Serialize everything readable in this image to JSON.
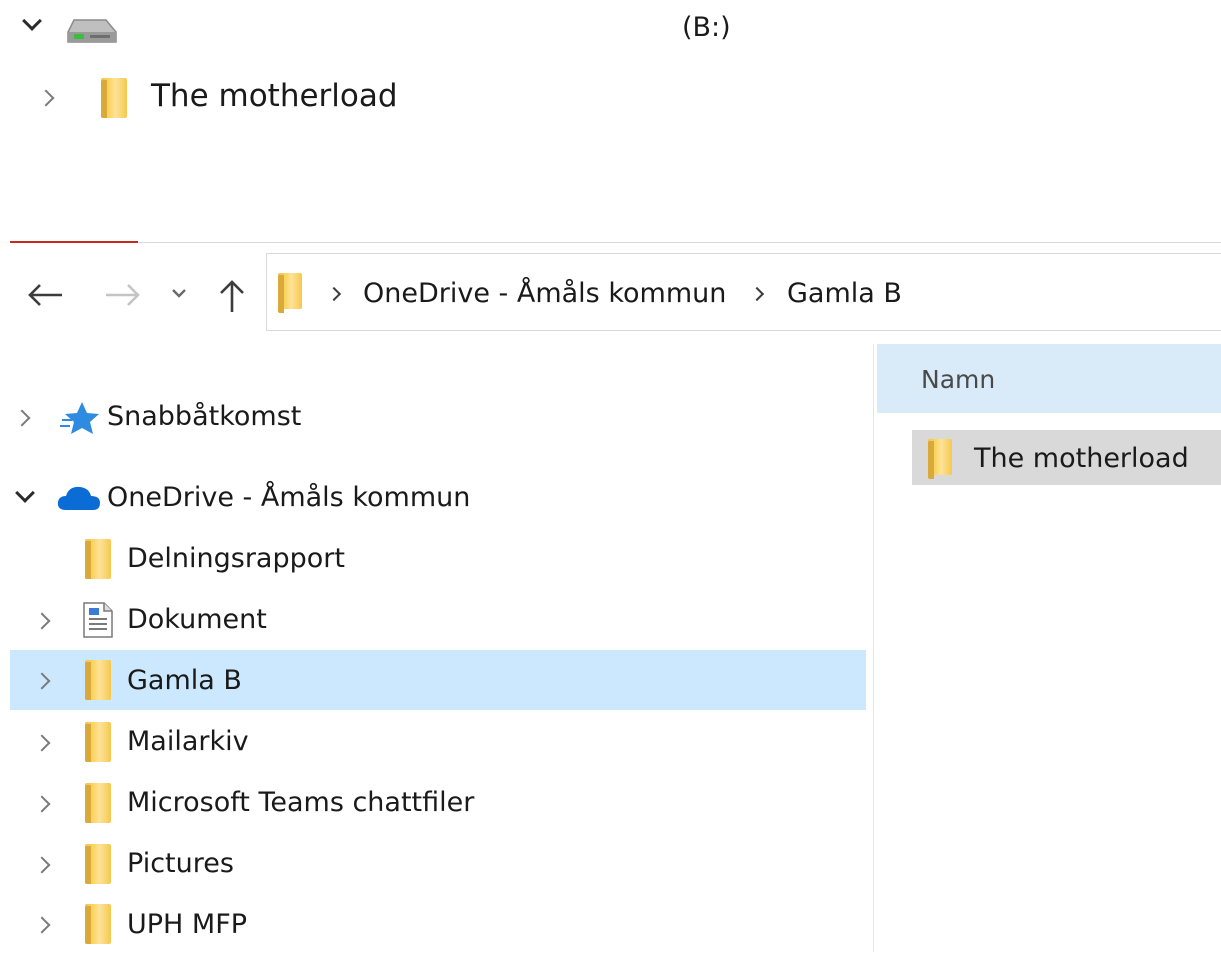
{
  "top_tree": {
    "drive_label": "(B:)",
    "child_folder": "The motherload"
  },
  "address_bar": {
    "crumbs": [
      "OneDrive - Åmåls kommun",
      "Gamla B"
    ]
  },
  "nav_pane": {
    "quick_access": "Snabbåtkomst",
    "onedrive": "OneDrive - Åmåls kommun",
    "items": [
      {
        "label": "Delningsrapport"
      },
      {
        "label": "Dokument"
      },
      {
        "label": "Gamla B"
      },
      {
        "label": "Mailarkiv"
      },
      {
        "label": "Microsoft Teams chattfiler"
      },
      {
        "label": "Pictures"
      },
      {
        "label": "UPH MFP"
      }
    ]
  },
  "file_list": {
    "column_name": "Namn",
    "rows": [
      {
        "name": "The motherload"
      }
    ]
  }
}
